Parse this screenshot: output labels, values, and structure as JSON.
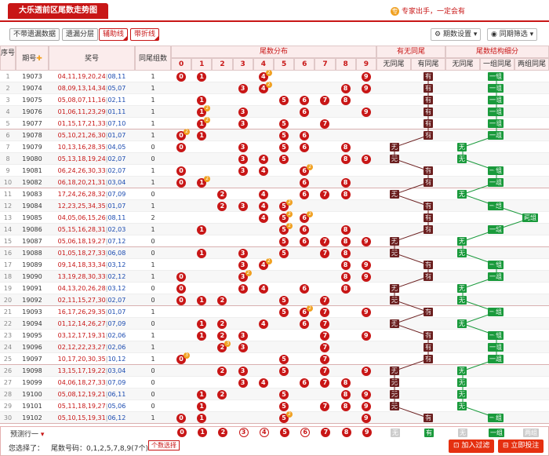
{
  "header": {
    "title": "大乐透前区尾数走势图",
    "promo": "专家出手，一定会有"
  },
  "toolbar": {
    "btn1": "不带遗漏数据",
    "btn2": "遗漏分层",
    "btn3": "辅助线",
    "btn4": "带折线",
    "sel1": "期数设置",
    "sel2": "同期筛选"
  },
  "columns": {
    "seq": "序号",
    "issue": "期号",
    "nums": "奖号",
    "group": "同尾组数",
    "dist": "尾数分布",
    "has": "有无同尾",
    "no_same": "无同尾",
    "has_same": "有同尾",
    "struct": "尾数结构细分",
    "s0": "无同尾",
    "s1": "一组同尾",
    "s2": "两组同尾",
    "digits": [
      "0",
      "1",
      "2",
      "3",
      "4",
      "5",
      "6",
      "7",
      "8",
      "9"
    ]
  },
  "rows": [
    {
      "seq": "1",
      "issue": "19073",
      "front": "04,11,19,20,24",
      "back": "08,11",
      "g": "1"
    },
    {
      "seq": "2",
      "issue": "19074",
      "front": "08,09,13,14,34",
      "back": "05,07",
      "g": "1"
    },
    {
      "seq": "3",
      "issue": "19075",
      "front": "05,08,07,11,16",
      "back": "02,11",
      "g": "1"
    },
    {
      "seq": "4",
      "issue": "19076",
      "front": "01,06,11,23,29",
      "back": "01,11",
      "g": "1"
    },
    {
      "seq": "5",
      "issue": "19077",
      "front": "01,15,17,21,33",
      "back": "07,10",
      "g": "1"
    },
    {
      "seq": "6",
      "issue": "19078",
      "front": "05,10,21,26,30",
      "back": "01,07",
      "g": "1"
    },
    {
      "seq": "7",
      "issue": "19079",
      "front": "10,13,16,28,35",
      "back": "04,05",
      "g": "0"
    },
    {
      "seq": "8",
      "issue": "19080",
      "front": "05,13,18,19,24",
      "back": "02,07",
      "g": "0"
    },
    {
      "seq": "9",
      "issue": "19081",
      "front": "06,24,26,30,33",
      "back": "02,07",
      "g": "1"
    },
    {
      "seq": "10",
      "issue": "19082",
      "front": "06,18,20,21,31",
      "back": "03,04",
      "g": "1"
    },
    {
      "seq": "11",
      "issue": "19083",
      "front": "17,24,26,28,32",
      "back": "07,09",
      "g": "0"
    },
    {
      "seq": "12",
      "issue": "19084",
      "front": "12,23,25,34,35",
      "back": "01,07",
      "g": "1"
    },
    {
      "seq": "13",
      "issue": "19085",
      "front": "04,05,06,15,26",
      "back": "08,11",
      "g": "2"
    },
    {
      "seq": "14",
      "issue": "19086",
      "front": "05,15,16,28,31",
      "back": "02,03",
      "g": "1"
    },
    {
      "seq": "15",
      "issue": "19087",
      "front": "05,06,18,19,27",
      "back": "07,12",
      "g": "0"
    },
    {
      "seq": "16",
      "issue": "19088",
      "front": "01,05,18,27,33",
      "back": "06,08",
      "g": "0"
    },
    {
      "seq": "17",
      "issue": "19089",
      "front": "09,14,18,33,34",
      "back": "03,12",
      "g": "1"
    },
    {
      "seq": "18",
      "issue": "19090",
      "front": "13,19,28,30,33",
      "back": "02,12",
      "g": "1"
    },
    {
      "seq": "19",
      "issue": "19091",
      "front": "04,13,20,26,28",
      "back": "03,12",
      "g": "0"
    },
    {
      "seq": "20",
      "issue": "19092",
      "front": "02,11,15,27,30",
      "back": "02,07",
      "g": "0"
    },
    {
      "seq": "21",
      "issue": "19093",
      "front": "16,17,26,29,35",
      "back": "01,07",
      "g": "1"
    },
    {
      "seq": "22",
      "issue": "19094",
      "front": "01,12,14,26,27",
      "back": "07,09",
      "g": "0"
    },
    {
      "seq": "23",
      "issue": "19095",
      "front": "03,12,17,19,31",
      "back": "02,06",
      "g": "1"
    },
    {
      "seq": "24",
      "issue": "19096",
      "front": "02,12,22,23,27",
      "back": "02,06",
      "g": "1"
    },
    {
      "seq": "25",
      "issue": "19097",
      "front": "10,17,20,30,35",
      "back": "10,12",
      "g": "1"
    },
    {
      "seq": "26",
      "issue": "19098",
      "front": "13,15,17,19,22",
      "back": "03,04",
      "g": "0"
    },
    {
      "seq": "27",
      "issue": "19099",
      "front": "04,06,18,27,33",
      "back": "07,09",
      "g": "0"
    },
    {
      "seq": "28",
      "issue": "19100",
      "front": "05,08,12,19,21",
      "back": "06,11",
      "g": "0"
    },
    {
      "seq": "29",
      "issue": "19101",
      "front": "05,11,18,19,27",
      "back": "05,06",
      "g": "0"
    },
    {
      "seq": "30",
      "issue": "19102",
      "front": "05,10,15,19,31",
      "back": "06,12",
      "g": "1"
    }
  ],
  "tags": {
    "wu": "无",
    "you": "有",
    "yizu": "一组",
    "liangzu": "两组"
  },
  "footer": {
    "predict": "预测行一",
    "selected_label": "您选择了：",
    "selected_text": "尾数号码：0,1,2,5,7,8,9(7个)",
    "count_btn": "个数选择",
    "filter_btn": "加入过滤",
    "bet_btn": "立即投注"
  },
  "colors": {
    "accent": "#c81616",
    "green": "#1a9a3c",
    "brown": "#6b1f1f"
  }
}
